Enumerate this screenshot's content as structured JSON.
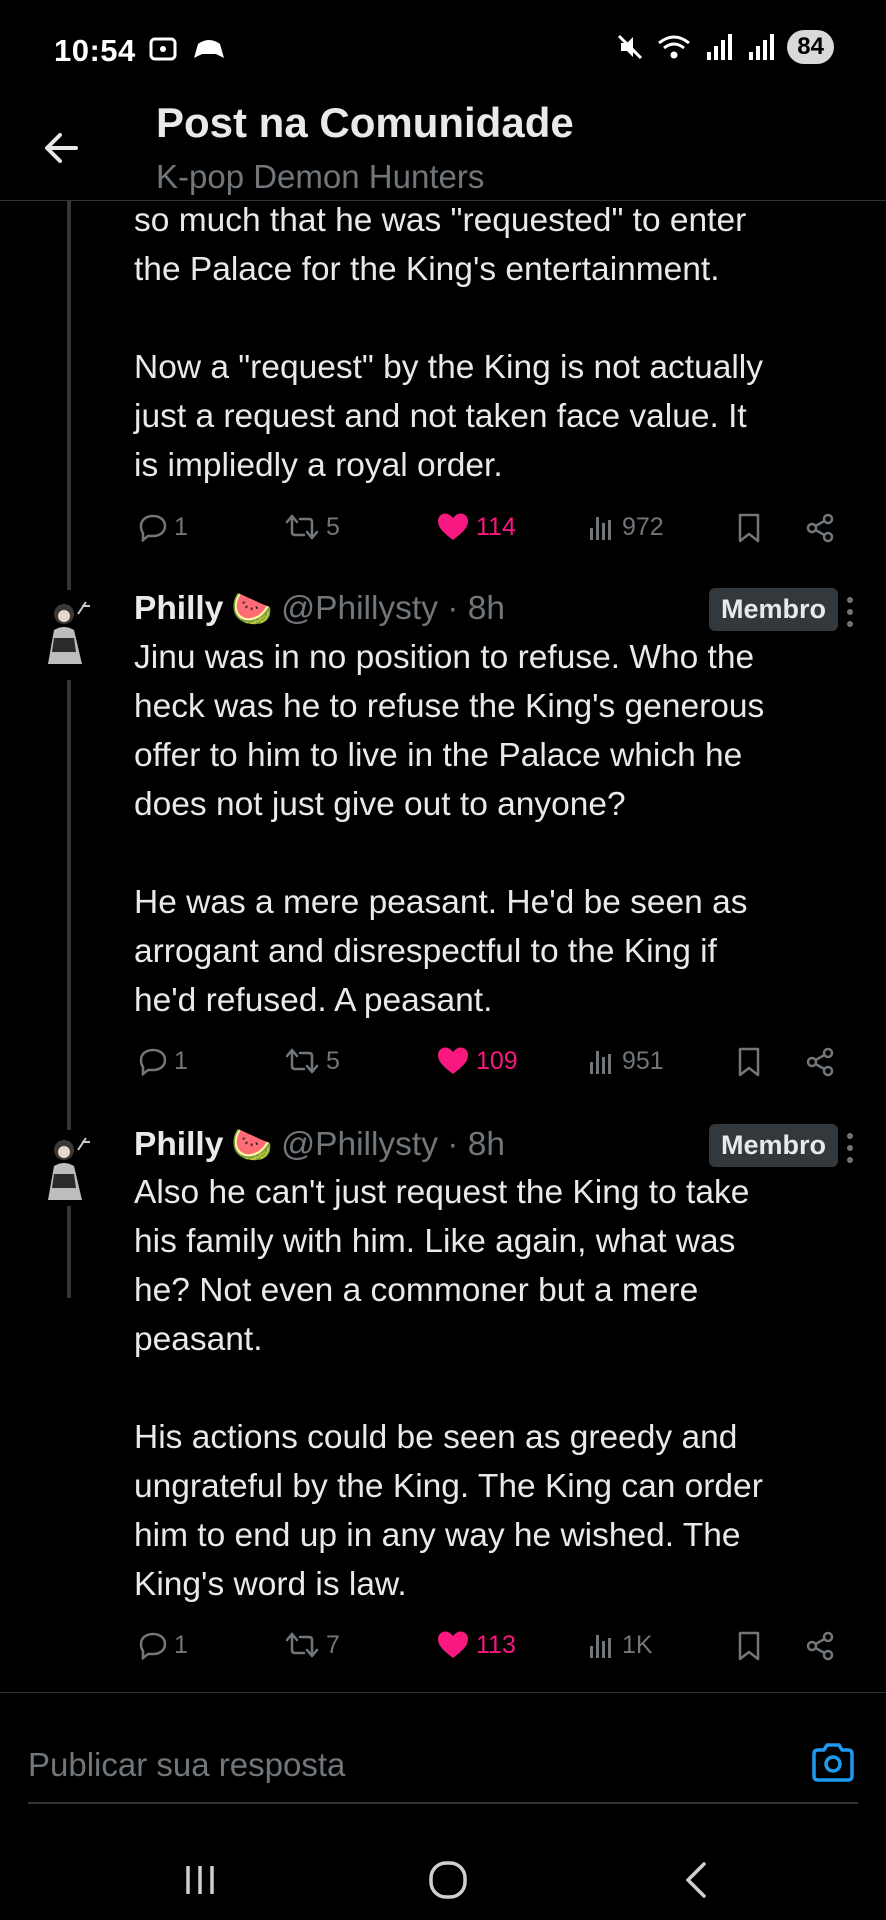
{
  "status_bar": {
    "time": "10:54",
    "battery": "84"
  },
  "header": {
    "title": "Post na Comunidade",
    "subtitle": "K-pop Demon Hunters"
  },
  "posts": [
    {
      "text": "so much that he was \"requested\" to enter\nthe Palace for the King's entertainment.\n\nNow a \"request\" by the King is not actually\njust a request and not taken face value. It\nis impliedly a royal order.",
      "replies": "1",
      "reposts": "5",
      "likes": "114",
      "views": "972"
    },
    {
      "name": "Philly",
      "emoji": "🍉",
      "handle": "@Phillysty · 8h",
      "badge": "Membro",
      "text": "Jinu was in no position to refuse. Who the\nheck was he to refuse the King's generous\noffer to him to live in the Palace which he\ndoes not just give out to anyone?\n\nHe was a mere peasant. He'd be seen as\narrogant and disrespectful to the King if\nhe'd refused. A peasant.",
      "replies": "1",
      "reposts": "5",
      "likes": "109",
      "views": "951"
    },
    {
      "name": "Philly",
      "emoji": "🍉",
      "handle": "@Phillysty · 8h",
      "badge": "Membro",
      "text": "Also he can't just request the King to take\nhis family with him. Like again, what was\nhe? Not even a commoner but a mere\npeasant.\n\nHis actions could be seen as greedy and\nungrateful by the King. The King can order\nhim to end up in any way he wished. The\nKing's word is law.",
      "replies": "1",
      "reposts": "7",
      "likes": "113",
      "views": "1K"
    }
  ],
  "reply_bar": {
    "placeholder": "Publicar sua resposta"
  },
  "colors": {
    "background": "#000000",
    "text": "#e7e9ea",
    "muted": "#71767b",
    "like": "#f91880",
    "accent": "#1d9bf0"
  }
}
